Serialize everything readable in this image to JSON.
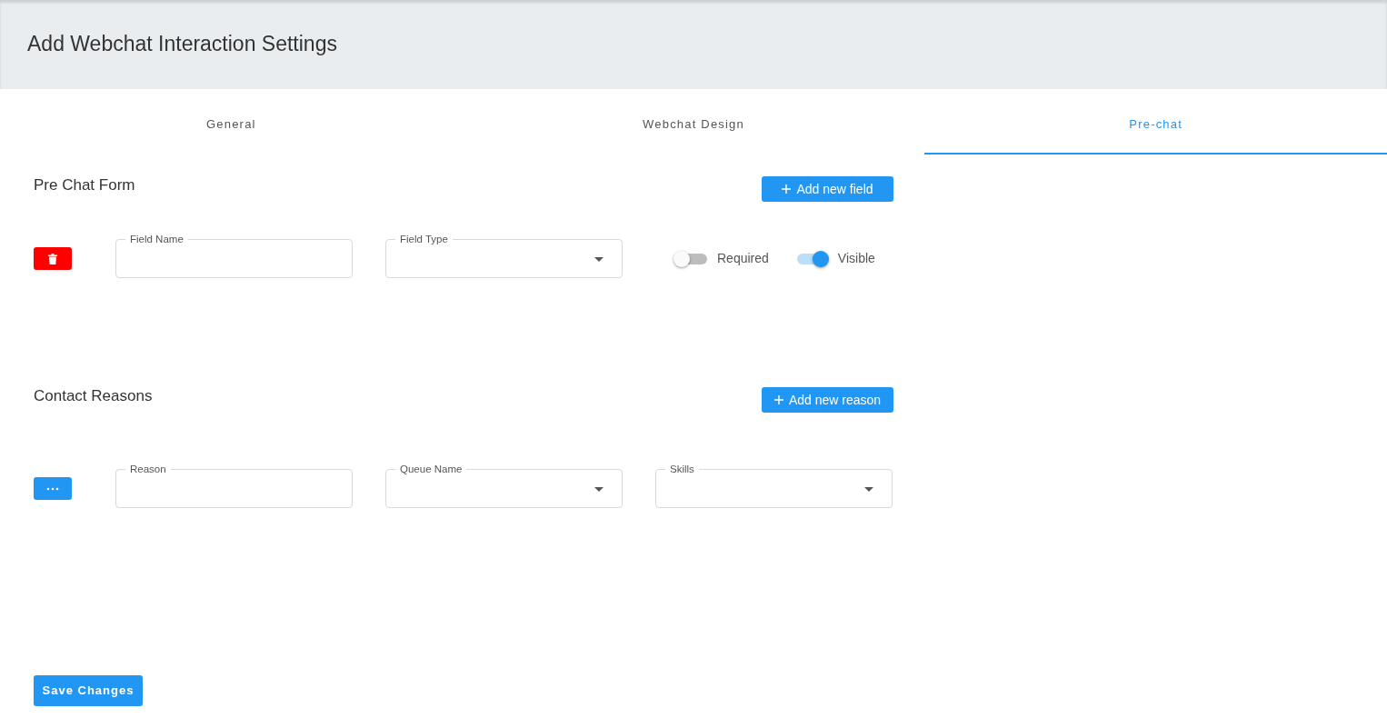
{
  "header": {
    "title": "Add Webchat Interaction Settings"
  },
  "tabs": [
    {
      "label": "General",
      "selected": false
    },
    {
      "label": "Webchat Design",
      "selected": false
    },
    {
      "label": "Pre-chat",
      "selected": true
    }
  ],
  "pre_chat_form": {
    "title": "Pre Chat Form",
    "add_button": "Add new field",
    "rows": [
      {
        "fields": [
          {
            "label": "Field Name",
            "kind": "text"
          },
          {
            "label": "Field Type",
            "kind": "select"
          }
        ],
        "switches": [
          {
            "label": "Required",
            "on": false
          },
          {
            "label": "Visible",
            "on": true
          }
        ]
      }
    ]
  },
  "contact_reasons": {
    "title": "Contact Reasons",
    "add_button": "Add new reason",
    "rows": [
      {
        "fields": [
          {
            "label": "Reason",
            "kind": "text"
          },
          {
            "label": "Queue Name",
            "kind": "select"
          },
          {
            "label": "Skills",
            "kind": "select"
          }
        ]
      }
    ]
  },
  "save_button": "Save Changes"
}
